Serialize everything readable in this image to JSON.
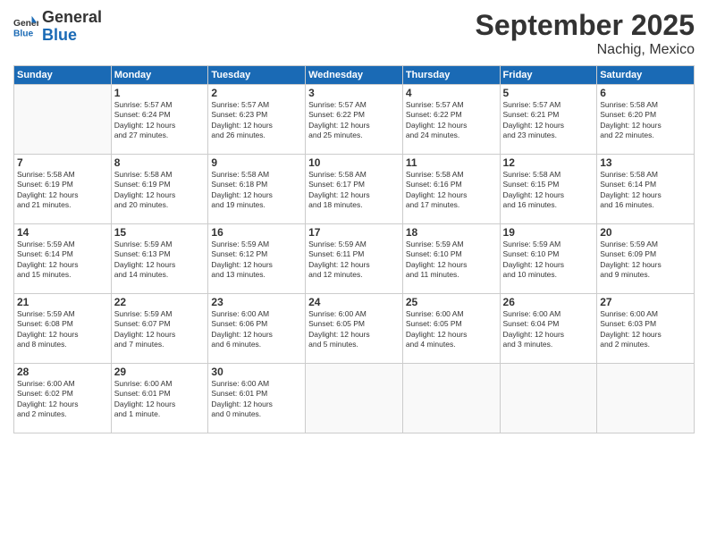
{
  "header": {
    "logo_general": "General",
    "logo_blue": "Blue",
    "month": "September 2025",
    "location": "Nachig, Mexico"
  },
  "weekdays": [
    "Sunday",
    "Monday",
    "Tuesday",
    "Wednesday",
    "Thursday",
    "Friday",
    "Saturday"
  ],
  "weeks": [
    [
      {
        "day": "",
        "info": ""
      },
      {
        "day": "1",
        "info": "Sunrise: 5:57 AM\nSunset: 6:24 PM\nDaylight: 12 hours\nand 27 minutes."
      },
      {
        "day": "2",
        "info": "Sunrise: 5:57 AM\nSunset: 6:23 PM\nDaylight: 12 hours\nand 26 minutes."
      },
      {
        "day": "3",
        "info": "Sunrise: 5:57 AM\nSunset: 6:22 PM\nDaylight: 12 hours\nand 25 minutes."
      },
      {
        "day": "4",
        "info": "Sunrise: 5:57 AM\nSunset: 6:22 PM\nDaylight: 12 hours\nand 24 minutes."
      },
      {
        "day": "5",
        "info": "Sunrise: 5:57 AM\nSunset: 6:21 PM\nDaylight: 12 hours\nand 23 minutes."
      },
      {
        "day": "6",
        "info": "Sunrise: 5:58 AM\nSunset: 6:20 PM\nDaylight: 12 hours\nand 22 minutes."
      }
    ],
    [
      {
        "day": "7",
        "info": "Sunrise: 5:58 AM\nSunset: 6:19 PM\nDaylight: 12 hours\nand 21 minutes."
      },
      {
        "day": "8",
        "info": "Sunrise: 5:58 AM\nSunset: 6:19 PM\nDaylight: 12 hours\nand 20 minutes."
      },
      {
        "day": "9",
        "info": "Sunrise: 5:58 AM\nSunset: 6:18 PM\nDaylight: 12 hours\nand 19 minutes."
      },
      {
        "day": "10",
        "info": "Sunrise: 5:58 AM\nSunset: 6:17 PM\nDaylight: 12 hours\nand 18 minutes."
      },
      {
        "day": "11",
        "info": "Sunrise: 5:58 AM\nSunset: 6:16 PM\nDaylight: 12 hours\nand 17 minutes."
      },
      {
        "day": "12",
        "info": "Sunrise: 5:58 AM\nSunset: 6:15 PM\nDaylight: 12 hours\nand 16 minutes."
      },
      {
        "day": "13",
        "info": "Sunrise: 5:58 AM\nSunset: 6:14 PM\nDaylight: 12 hours\nand 16 minutes."
      }
    ],
    [
      {
        "day": "14",
        "info": "Sunrise: 5:59 AM\nSunset: 6:14 PM\nDaylight: 12 hours\nand 15 minutes."
      },
      {
        "day": "15",
        "info": "Sunrise: 5:59 AM\nSunset: 6:13 PM\nDaylight: 12 hours\nand 14 minutes."
      },
      {
        "day": "16",
        "info": "Sunrise: 5:59 AM\nSunset: 6:12 PM\nDaylight: 12 hours\nand 13 minutes."
      },
      {
        "day": "17",
        "info": "Sunrise: 5:59 AM\nSunset: 6:11 PM\nDaylight: 12 hours\nand 12 minutes."
      },
      {
        "day": "18",
        "info": "Sunrise: 5:59 AM\nSunset: 6:10 PM\nDaylight: 12 hours\nand 11 minutes."
      },
      {
        "day": "19",
        "info": "Sunrise: 5:59 AM\nSunset: 6:10 PM\nDaylight: 12 hours\nand 10 minutes."
      },
      {
        "day": "20",
        "info": "Sunrise: 5:59 AM\nSunset: 6:09 PM\nDaylight: 12 hours\nand 9 minutes."
      }
    ],
    [
      {
        "day": "21",
        "info": "Sunrise: 5:59 AM\nSunset: 6:08 PM\nDaylight: 12 hours\nand 8 minutes."
      },
      {
        "day": "22",
        "info": "Sunrise: 5:59 AM\nSunset: 6:07 PM\nDaylight: 12 hours\nand 7 minutes."
      },
      {
        "day": "23",
        "info": "Sunrise: 6:00 AM\nSunset: 6:06 PM\nDaylight: 12 hours\nand 6 minutes."
      },
      {
        "day": "24",
        "info": "Sunrise: 6:00 AM\nSunset: 6:05 PM\nDaylight: 12 hours\nand 5 minutes."
      },
      {
        "day": "25",
        "info": "Sunrise: 6:00 AM\nSunset: 6:05 PM\nDaylight: 12 hours\nand 4 minutes."
      },
      {
        "day": "26",
        "info": "Sunrise: 6:00 AM\nSunset: 6:04 PM\nDaylight: 12 hours\nand 3 minutes."
      },
      {
        "day": "27",
        "info": "Sunrise: 6:00 AM\nSunset: 6:03 PM\nDaylight: 12 hours\nand 2 minutes."
      }
    ],
    [
      {
        "day": "28",
        "info": "Sunrise: 6:00 AM\nSunset: 6:02 PM\nDaylight: 12 hours\nand 2 minutes."
      },
      {
        "day": "29",
        "info": "Sunrise: 6:00 AM\nSunset: 6:01 PM\nDaylight: 12 hours\nand 1 minute."
      },
      {
        "day": "30",
        "info": "Sunrise: 6:00 AM\nSunset: 6:01 PM\nDaylight: 12 hours\nand 0 minutes."
      },
      {
        "day": "",
        "info": ""
      },
      {
        "day": "",
        "info": ""
      },
      {
        "day": "",
        "info": ""
      },
      {
        "day": "",
        "info": ""
      }
    ]
  ]
}
